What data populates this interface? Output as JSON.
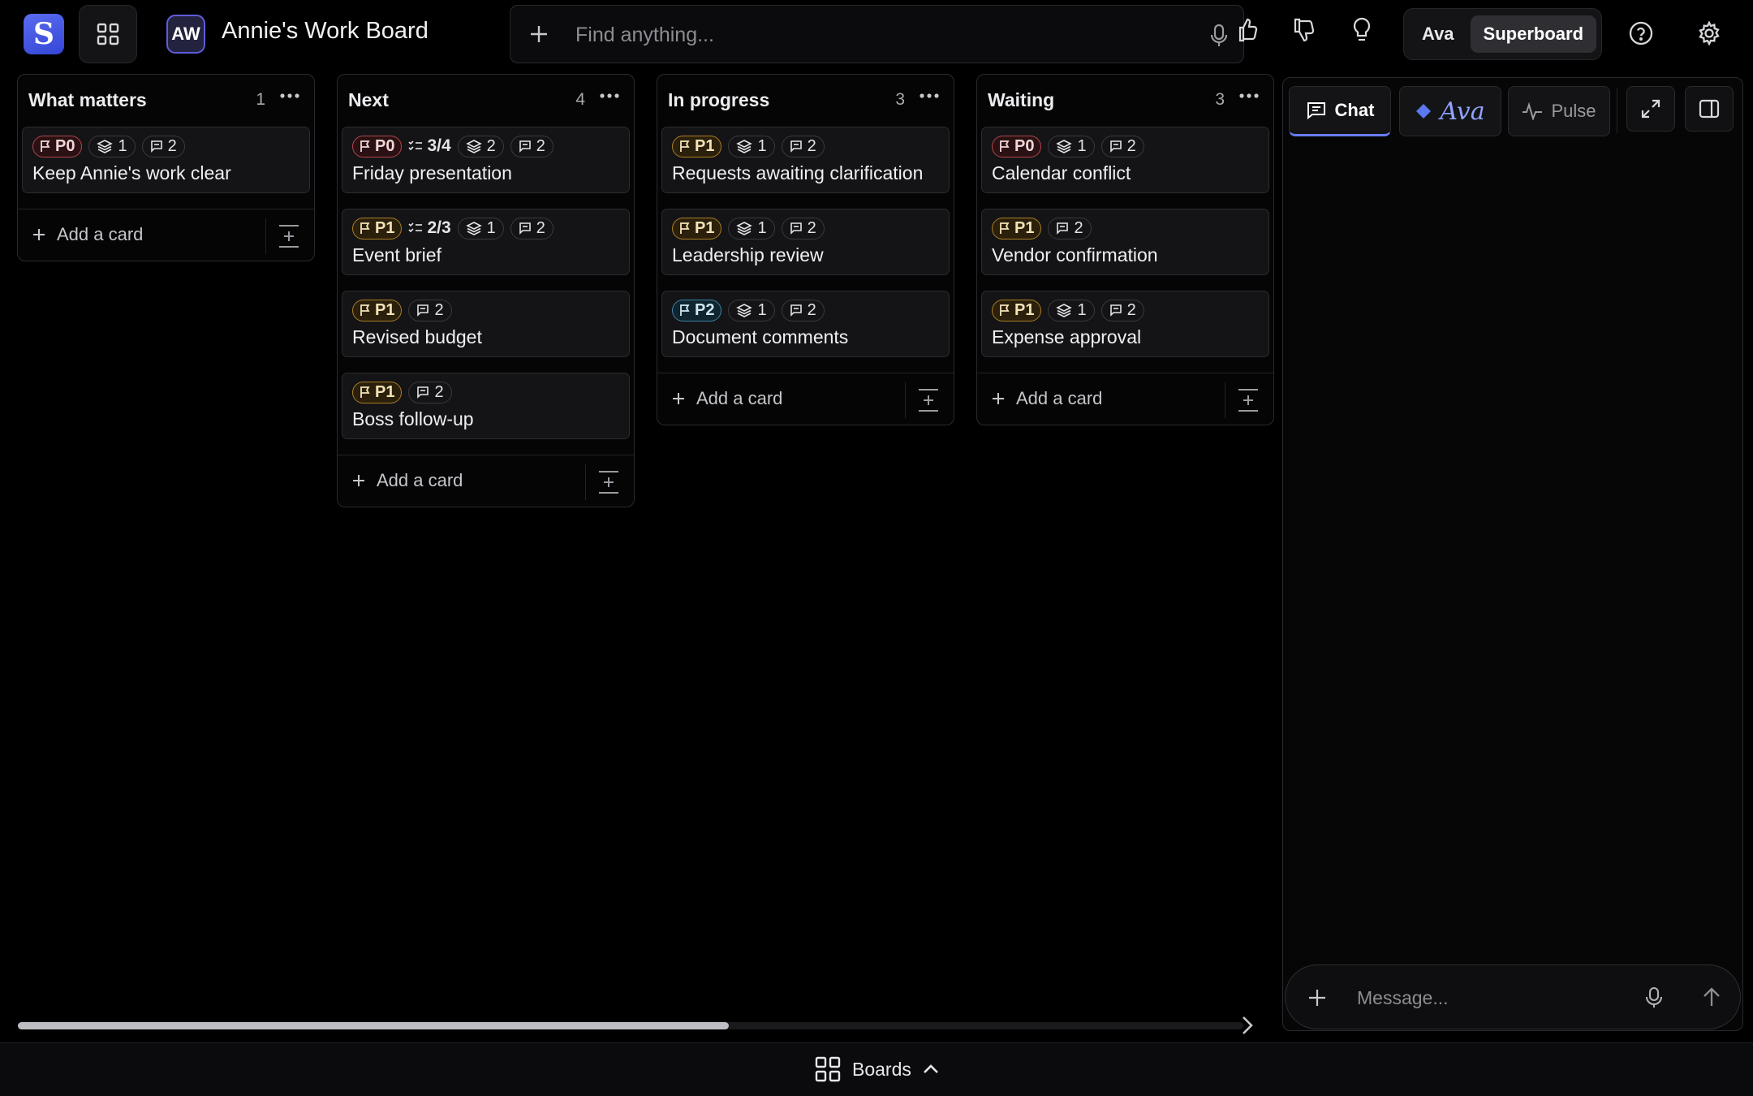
{
  "app": {
    "logo_letter": "S",
    "board_initials": "AW",
    "board_title": "Annie's Work Board"
  },
  "search": {
    "placeholder": "Find anything..."
  },
  "mode": {
    "options": [
      "Ava",
      "Superboard"
    ],
    "active": "Superboard"
  },
  "columns": [
    {
      "title": "What matters",
      "count": "1",
      "cards": [
        {
          "priority": "P0",
          "checklist": "",
          "subtasks": "1",
          "comments": "2",
          "title": "Keep Annie's work clear"
        }
      ],
      "add_label": "Add a card"
    },
    {
      "title": "Next",
      "count": "4",
      "cards": [
        {
          "priority": "P0",
          "checklist": "3/4",
          "subtasks": "2",
          "comments": "2",
          "title": "Friday presentation"
        },
        {
          "priority": "P1",
          "checklist": "2/3",
          "subtasks": "1",
          "comments": "2",
          "title": "Event brief"
        },
        {
          "priority": "P1",
          "checklist": "",
          "subtasks": "",
          "comments": "2",
          "title": "Revised budget"
        },
        {
          "priority": "P1",
          "checklist": "",
          "subtasks": "",
          "comments": "2",
          "title": "Boss follow-up"
        }
      ],
      "add_label": "Add a card"
    },
    {
      "title": "In progress",
      "count": "3",
      "cards": [
        {
          "priority": "P1",
          "checklist": "",
          "subtasks": "1",
          "comments": "2",
          "title": "Requests awaiting clarification"
        },
        {
          "priority": "P1",
          "checklist": "",
          "subtasks": "1",
          "comments": "2",
          "title": "Leadership review"
        },
        {
          "priority": "P2",
          "checklist": "",
          "subtasks": "1",
          "comments": "2",
          "title": "Document comments"
        }
      ],
      "add_label": "Add a card"
    },
    {
      "title": "Waiting",
      "count": "3",
      "cards": [
        {
          "priority": "P0",
          "checklist": "",
          "subtasks": "1",
          "comments": "2",
          "title": "Calendar conflict"
        },
        {
          "priority": "P1",
          "checklist": "",
          "subtasks": "",
          "comments": "2",
          "title": "Vendor confirmation"
        },
        {
          "priority": "P1",
          "checklist": "",
          "subtasks": "1",
          "comments": "2",
          "title": "Expense approval"
        }
      ],
      "add_label": "Add a card"
    }
  ],
  "scroll": {
    "position_fraction": 0.58
  },
  "panel": {
    "tabs": [
      {
        "label": "Chat",
        "icon": "chat-icon",
        "active": true
      },
      {
        "label": "Ava",
        "icon": "diamond-icon",
        "active": false
      },
      {
        "label": "Pulse",
        "icon": "pulse-icon",
        "active": false
      }
    ],
    "message_placeholder": "Message..."
  },
  "bottom": {
    "boards_label": "Boards"
  },
  "colors": {
    "accent": "#6a7cf6",
    "p0": "#b2464c",
    "p1": "#a97e25",
    "p2": "#3f82a0"
  }
}
